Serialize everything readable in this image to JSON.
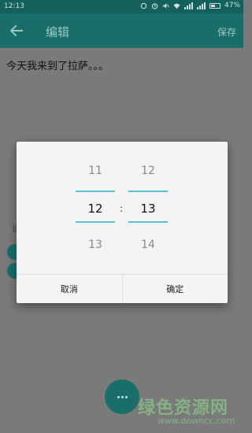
{
  "status_bar": {
    "time": "12:13",
    "battery": "47%"
  },
  "app_bar": {
    "title": "编辑",
    "save": "保存"
  },
  "note": {
    "text": "今天我来到了拉萨。。。"
  },
  "time_picker": {
    "hours": {
      "prev": "11",
      "selected": "12",
      "next": "13"
    },
    "separator": ":",
    "minutes": {
      "prev": "12",
      "selected": "13",
      "next": "14"
    },
    "cancel": "取消",
    "confirm": "确定"
  },
  "watermark": {
    "logo": "绿色资源网",
    "url": "www.downcc.com"
  }
}
